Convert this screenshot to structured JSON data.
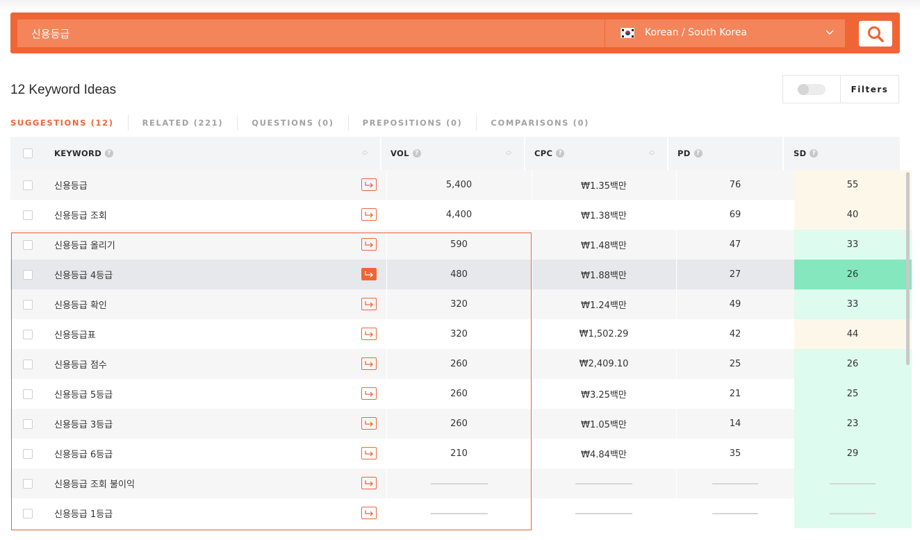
{
  "search": {
    "query": "신용등급",
    "language_label": "Korean / South Korea"
  },
  "summary": {
    "title": "12 Keyword Ideas"
  },
  "filters": {
    "label": "Filters"
  },
  "tabs": [
    {
      "label": "SUGGESTIONS (12)"
    },
    {
      "label": "RELATED (221)"
    },
    {
      "label": "QUESTIONS (0)"
    },
    {
      "label": "PREPOSITIONS (0)"
    },
    {
      "label": "COMPARISONS (0)"
    }
  ],
  "columns": {
    "keyword": "KEYWORD",
    "vol": "VOL",
    "cpc": "CPC",
    "pd": "PD",
    "sd": "SD"
  },
  "rows": [
    {
      "keyword": "신용등급",
      "vol": "5,400",
      "cpc": "₩1.35백만",
      "pd": "76",
      "sd": "55"
    },
    {
      "keyword": "신용등급 조회",
      "vol": "4,400",
      "cpc": "₩1.38백만",
      "pd": "69",
      "sd": "40"
    },
    {
      "keyword": "신용등급 올리기",
      "vol": "590",
      "cpc": "₩1.48백만",
      "pd": "47",
      "sd": "33"
    },
    {
      "keyword": "신용등급 4등급",
      "vol": "480",
      "cpc": "₩1.88백만",
      "pd": "27",
      "sd": "26"
    },
    {
      "keyword": "신용등급 확인",
      "vol": "320",
      "cpc": "₩1.24백만",
      "pd": "49",
      "sd": "33"
    },
    {
      "keyword": "신용등급표",
      "vol": "320",
      "cpc": "₩1,502.29",
      "pd": "42",
      "sd": "44"
    },
    {
      "keyword": "신용등급 점수",
      "vol": "260",
      "cpc": "₩2,409.10",
      "pd": "25",
      "sd": "26"
    },
    {
      "keyword": "신용등급 5등급",
      "vol": "260",
      "cpc": "₩3.25백만",
      "pd": "21",
      "sd": "25"
    },
    {
      "keyword": "신용등급 3등급",
      "vol": "260",
      "cpc": "₩1.05백만",
      "pd": "14",
      "sd": "23"
    },
    {
      "keyword": "신용등급 6등급",
      "vol": "210",
      "cpc": "₩4.84백만",
      "pd": "35",
      "sd": "29"
    },
    {
      "keyword": "신용등급 조회 불이익",
      "vol": "",
      "cpc": "",
      "pd": "",
      "sd": ""
    },
    {
      "keyword": "신용등급 1등급",
      "vol": "",
      "cpc": "",
      "pd": "",
      "sd": ""
    }
  ],
  "colors": {
    "accent": "#f06535",
    "sd_medium": "#fdf7ea",
    "sd_easy": "#ddfbee",
    "sd_easy_highlight": "#84e7bd"
  },
  "icons": {
    "search": "search-icon",
    "dropdown": "chevron-down-icon",
    "row_action": "arrow-return-icon",
    "help": "question-mark-icon",
    "sort": "sort-icon",
    "flag": "south-korea-flag-icon"
  }
}
